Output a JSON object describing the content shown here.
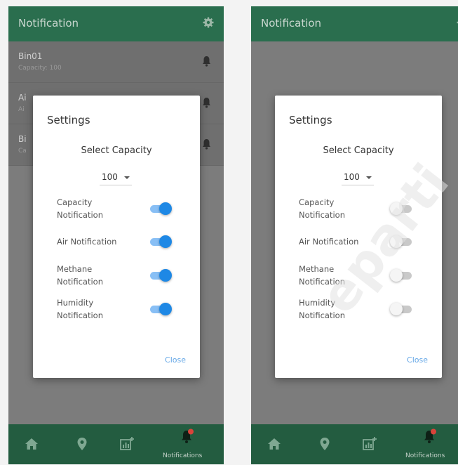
{
  "left_screen": {
    "appbar": {
      "title": "Notification",
      "settings_icon": "gear-icon"
    },
    "bins": [
      {
        "name": "Bin01",
        "subtitle": "Capacity: 100"
      },
      {
        "name": "Ai",
        "subtitle": "Ai"
      },
      {
        "name": "Bi",
        "subtitle": "Ca"
      }
    ],
    "dialog": {
      "title": "Settings",
      "subtitle": "Select Capacity",
      "capacity_value": "100",
      "options": [
        {
          "label": "Capacity Notification",
          "enabled": true
        },
        {
          "label": "Air Notification",
          "enabled": true
        },
        {
          "label": "Methane Notification",
          "enabled": true
        },
        {
          "label": "Humidity Notification",
          "enabled": true
        }
      ],
      "close_label": "Close"
    },
    "navbar": {
      "active_label": "Notifications",
      "icons": [
        "home-icon",
        "location-pin-icon",
        "chart-add-icon",
        "bell-icon"
      ]
    }
  },
  "right_screen": {
    "appbar": {
      "title": "Notification",
      "settings_icon": "gear-icon"
    },
    "dialog": {
      "title": "Settings",
      "subtitle": "Select Capacity",
      "capacity_value": "100",
      "options": [
        {
          "label": "Capacity Notification",
          "enabled": false
        },
        {
          "label": "Air Notification",
          "enabled": false
        },
        {
          "label": "Methane Notification",
          "enabled": false
        },
        {
          "label": "Humidity Notification",
          "enabled": false
        }
      ],
      "close_label": "Close"
    },
    "navbar": {
      "active_label": "Notifications",
      "icons": [
        "home-icon",
        "location-pin-icon",
        "chart-add-icon",
        "bell-icon"
      ]
    }
  },
  "colors": {
    "appbar": "#2a6e4e",
    "navbar": "#235c40",
    "toggle_on": "#1e88e5",
    "close_link": "#62a6e6",
    "badge": "#d9433a"
  },
  "watermark": {
    "text": "eparti"
  }
}
